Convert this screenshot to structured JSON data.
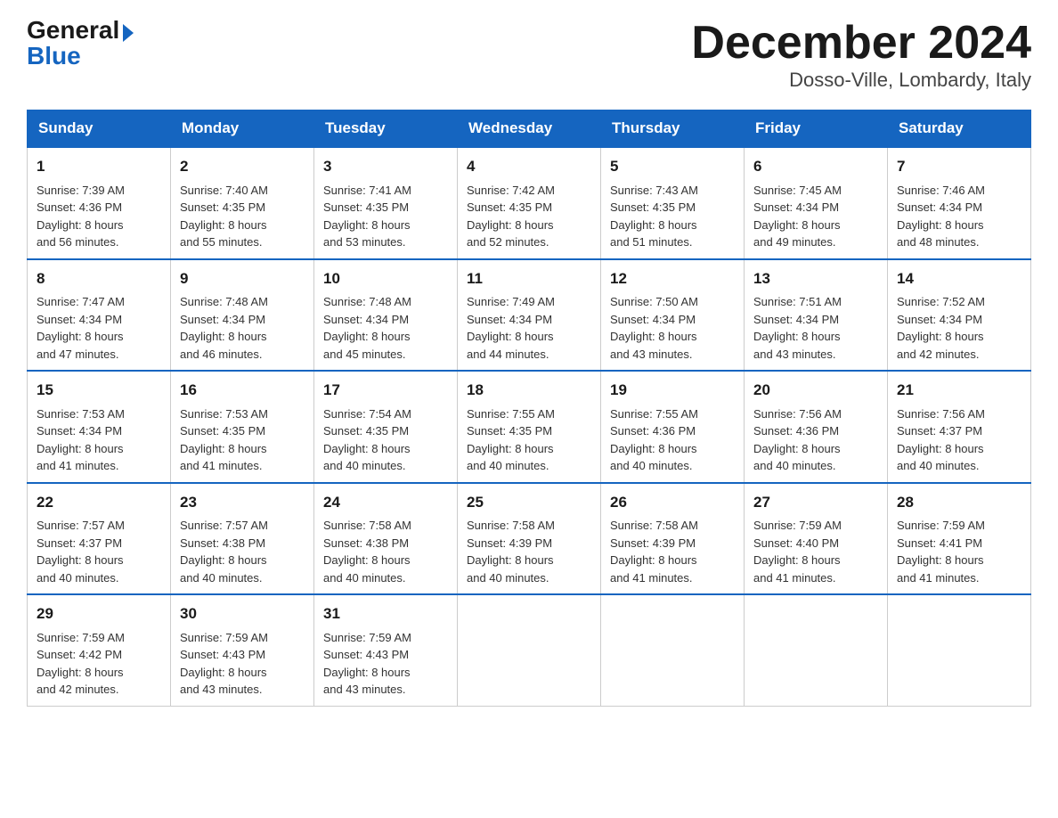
{
  "logo": {
    "general": "General",
    "blue": "Blue"
  },
  "title": "December 2024",
  "location": "Dosso-Ville, Lombardy, Italy",
  "headers": [
    "Sunday",
    "Monday",
    "Tuesday",
    "Wednesday",
    "Thursday",
    "Friday",
    "Saturday"
  ],
  "weeks": [
    [
      {
        "day": "1",
        "sunrise": "7:39 AM",
        "sunset": "4:36 PM",
        "daylight": "8 hours and 56 minutes."
      },
      {
        "day": "2",
        "sunrise": "7:40 AM",
        "sunset": "4:35 PM",
        "daylight": "8 hours and 55 minutes."
      },
      {
        "day": "3",
        "sunrise": "7:41 AM",
        "sunset": "4:35 PM",
        "daylight": "8 hours and 53 minutes."
      },
      {
        "day": "4",
        "sunrise": "7:42 AM",
        "sunset": "4:35 PM",
        "daylight": "8 hours and 52 minutes."
      },
      {
        "day": "5",
        "sunrise": "7:43 AM",
        "sunset": "4:35 PM",
        "daylight": "8 hours and 51 minutes."
      },
      {
        "day": "6",
        "sunrise": "7:45 AM",
        "sunset": "4:34 PM",
        "daylight": "8 hours and 49 minutes."
      },
      {
        "day": "7",
        "sunrise": "7:46 AM",
        "sunset": "4:34 PM",
        "daylight": "8 hours and 48 minutes."
      }
    ],
    [
      {
        "day": "8",
        "sunrise": "7:47 AM",
        "sunset": "4:34 PM",
        "daylight": "8 hours and 47 minutes."
      },
      {
        "day": "9",
        "sunrise": "7:48 AM",
        "sunset": "4:34 PM",
        "daylight": "8 hours and 46 minutes."
      },
      {
        "day": "10",
        "sunrise": "7:48 AM",
        "sunset": "4:34 PM",
        "daylight": "8 hours and 45 minutes."
      },
      {
        "day": "11",
        "sunrise": "7:49 AM",
        "sunset": "4:34 PM",
        "daylight": "8 hours and 44 minutes."
      },
      {
        "day": "12",
        "sunrise": "7:50 AM",
        "sunset": "4:34 PM",
        "daylight": "8 hours and 43 minutes."
      },
      {
        "day": "13",
        "sunrise": "7:51 AM",
        "sunset": "4:34 PM",
        "daylight": "8 hours and 43 minutes."
      },
      {
        "day": "14",
        "sunrise": "7:52 AM",
        "sunset": "4:34 PM",
        "daylight": "8 hours and 42 minutes."
      }
    ],
    [
      {
        "day": "15",
        "sunrise": "7:53 AM",
        "sunset": "4:34 PM",
        "daylight": "8 hours and 41 minutes."
      },
      {
        "day": "16",
        "sunrise": "7:53 AM",
        "sunset": "4:35 PM",
        "daylight": "8 hours and 41 minutes."
      },
      {
        "day": "17",
        "sunrise": "7:54 AM",
        "sunset": "4:35 PM",
        "daylight": "8 hours and 40 minutes."
      },
      {
        "day": "18",
        "sunrise": "7:55 AM",
        "sunset": "4:35 PM",
        "daylight": "8 hours and 40 minutes."
      },
      {
        "day": "19",
        "sunrise": "7:55 AM",
        "sunset": "4:36 PM",
        "daylight": "8 hours and 40 minutes."
      },
      {
        "day": "20",
        "sunrise": "7:56 AM",
        "sunset": "4:36 PM",
        "daylight": "8 hours and 40 minutes."
      },
      {
        "day": "21",
        "sunrise": "7:56 AM",
        "sunset": "4:37 PM",
        "daylight": "8 hours and 40 minutes."
      }
    ],
    [
      {
        "day": "22",
        "sunrise": "7:57 AM",
        "sunset": "4:37 PM",
        "daylight": "8 hours and 40 minutes."
      },
      {
        "day": "23",
        "sunrise": "7:57 AM",
        "sunset": "4:38 PM",
        "daylight": "8 hours and 40 minutes."
      },
      {
        "day": "24",
        "sunrise": "7:58 AM",
        "sunset": "4:38 PM",
        "daylight": "8 hours and 40 minutes."
      },
      {
        "day": "25",
        "sunrise": "7:58 AM",
        "sunset": "4:39 PM",
        "daylight": "8 hours and 40 minutes."
      },
      {
        "day": "26",
        "sunrise": "7:58 AM",
        "sunset": "4:39 PM",
        "daylight": "8 hours and 41 minutes."
      },
      {
        "day": "27",
        "sunrise": "7:59 AM",
        "sunset": "4:40 PM",
        "daylight": "8 hours and 41 minutes."
      },
      {
        "day": "28",
        "sunrise": "7:59 AM",
        "sunset": "4:41 PM",
        "daylight": "8 hours and 41 minutes."
      }
    ],
    [
      {
        "day": "29",
        "sunrise": "7:59 AM",
        "sunset": "4:42 PM",
        "daylight": "8 hours and 42 minutes."
      },
      {
        "day": "30",
        "sunrise": "7:59 AM",
        "sunset": "4:43 PM",
        "daylight": "8 hours and 43 minutes."
      },
      {
        "day": "31",
        "sunrise": "7:59 AM",
        "sunset": "4:43 PM",
        "daylight": "8 hours and 43 minutes."
      },
      null,
      null,
      null,
      null
    ]
  ],
  "labels": {
    "sunrise": "Sunrise:",
    "sunset": "Sunset:",
    "daylight": "Daylight:"
  }
}
